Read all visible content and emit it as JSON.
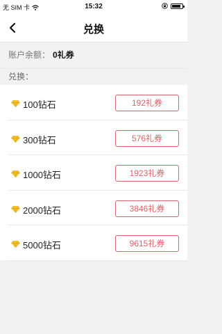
{
  "status": {
    "carrier": "无 SIM 卡",
    "time": "15:32"
  },
  "nav": {
    "title": "兑换"
  },
  "balance": {
    "label": "账户余额：",
    "value": "0礼券"
  },
  "section": {
    "label": "兑换："
  },
  "items": [
    {
      "amount": "100钻石",
      "price": "192礼券"
    },
    {
      "amount": "300钻石",
      "price": "576礼券"
    },
    {
      "amount": "1000钻石",
      "price": "1923礼券"
    },
    {
      "amount": "2000钻石",
      "price": "3846礼券"
    },
    {
      "amount": "5000钻石",
      "price": "9615礼券"
    }
  ],
  "colors": {
    "accent": "#d9646a",
    "diamond": "#f2c12e",
    "background": "#f2f2f2"
  },
  "icons": {
    "back": "chevron-left-icon",
    "diamond": "diamond-icon",
    "wifi": "wifi-icon",
    "lock": "orientation-lock-icon",
    "battery": "battery-icon"
  }
}
